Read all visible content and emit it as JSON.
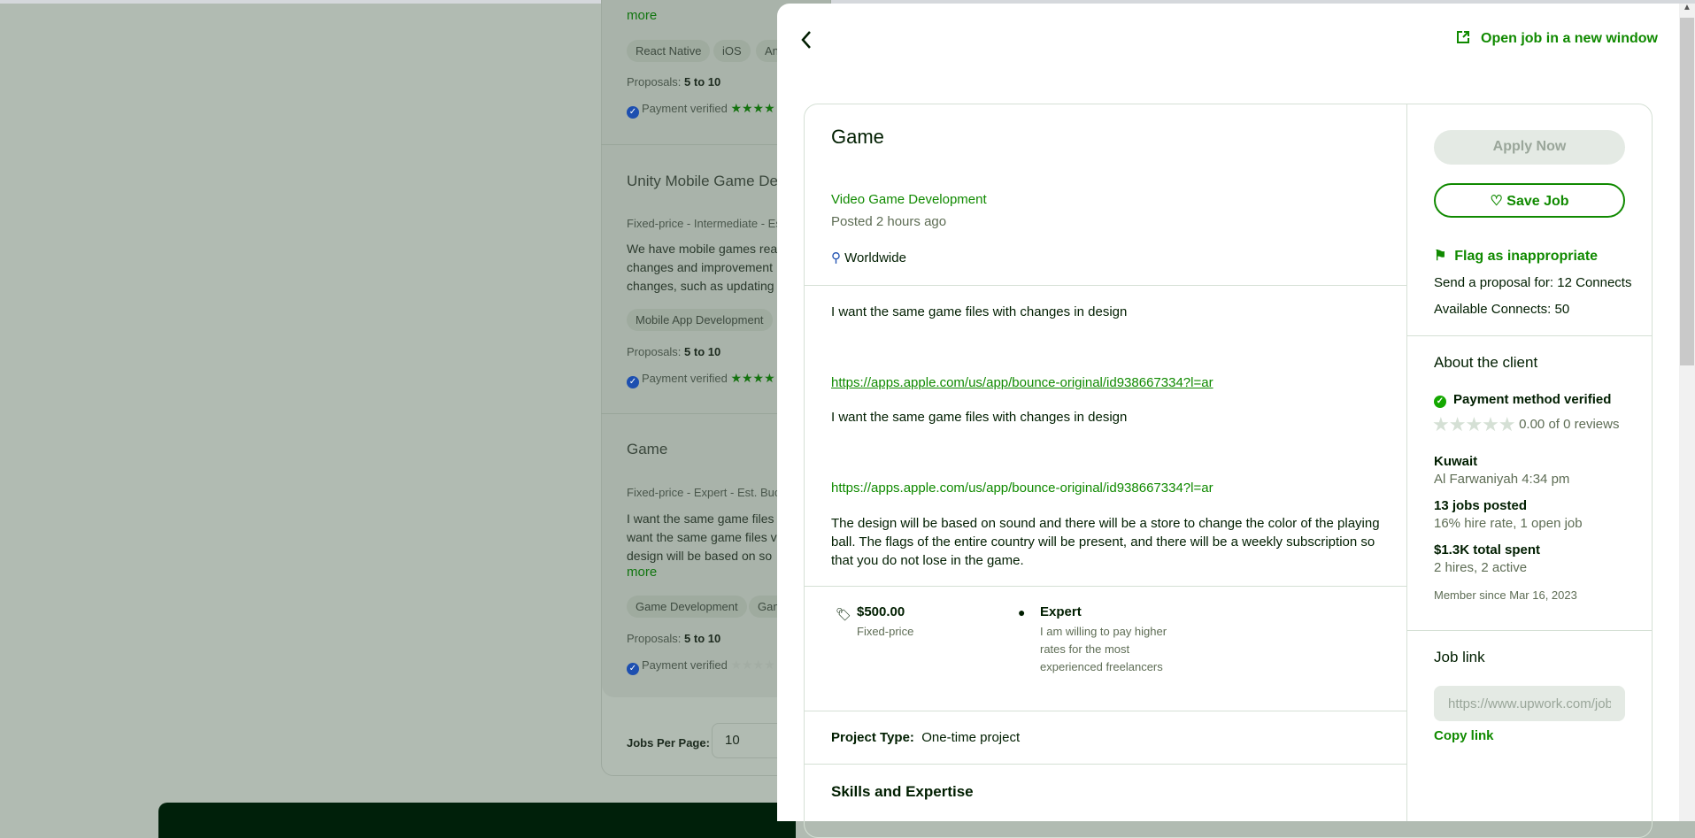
{
  "background_list": {
    "items": [
      {
        "more": "more",
        "tags": [
          "React Native",
          "iOS",
          "An"
        ],
        "proposals_label": "Proposals:",
        "proposals": "5 to 10",
        "payment": "Payment verified",
        "stars": 4
      },
      {
        "title": "Unity Mobile Game Dev",
        "meta": "Fixed-price - Intermediate - Es",
        "desc": [
          "We have mobile games rea",
          "changes and improvement",
          "changes, such as updating"
        ],
        "tags": [
          "Mobile App Development"
        ],
        "proposals_label": "Proposals:",
        "proposals": "5 to 10",
        "payment": "Payment verified",
        "stars": 4
      },
      {
        "title": "Game",
        "meta": "Fixed-price - Expert - Est. Buc",
        "desc": [
          "I want the same game files",
          "want the same game files v",
          "design will be based on so"
        ],
        "more": "more",
        "tags": [
          "Game Development",
          "Gam"
        ],
        "proposals_label": "Proposals:",
        "proposals": "5 to 10",
        "payment": "Payment verified",
        "stars": 0
      }
    ],
    "jobs_per_page_label": "Jobs Per Page:",
    "jobs_per_page": "10"
  },
  "panel": {
    "back_icon": "chevron-left-icon",
    "open_new_window": "Open job in a new window",
    "job": {
      "title": "Game",
      "category": "Video Game Development",
      "posted": "Posted 2 hours ago",
      "location": "Worldwide",
      "description": [
        "I want the same game files with changes in design",
        "https://apps.apple.com/us/app/bounce-original/id938667334?l=ar",
        "I want the same game files with changes in design",
        "https://apps.apple.com/us/app/bounce-original/id938667334?l=ar",
        "The design will be based on sound and there will be a store to change the color of the playing",
        "ball. The flags of the entire country will be present, and there will be a weekly subscription so",
        "that you do not lose in the game."
      ],
      "price": "$500.00",
      "price_type": "Fixed-price",
      "level": "Expert",
      "level_desc": [
        "I am willing to pay higher",
        "rates for the most",
        "experienced freelancers"
      ],
      "project_type_label": "Project Type:",
      "project_type": "One-time project",
      "skills_heading": "Skills and Expertise"
    },
    "sidebar": {
      "apply": "Apply Now",
      "save": "Save Job",
      "flag": "Flag as inappropriate",
      "send_proposal": "Send a proposal for: 12 Connects",
      "available": "Available Connects: 50",
      "about_heading": "About the client",
      "payment_verified": "Payment method verified",
      "reviews": "0.00 of 0 reviews",
      "rating": 0,
      "country": "Kuwait",
      "city_time": "Al Farwaniyah 4:34 pm",
      "jobs_posted": "13 jobs posted",
      "hire_rate": "16% hire rate, 1 open job",
      "total_spent": "$1.3K total spent",
      "hires": "2 hires, 2 active",
      "member_since": "Member since Mar 16, 2023",
      "job_link_heading": "Job link",
      "job_link_value": "https://www.upwork.com/jobs/",
      "copy_link": "Copy link"
    }
  },
  "colors": {
    "brand_green": "#108a00",
    "overlay": "#b1bbb2",
    "dark_bar": "#00200a"
  }
}
